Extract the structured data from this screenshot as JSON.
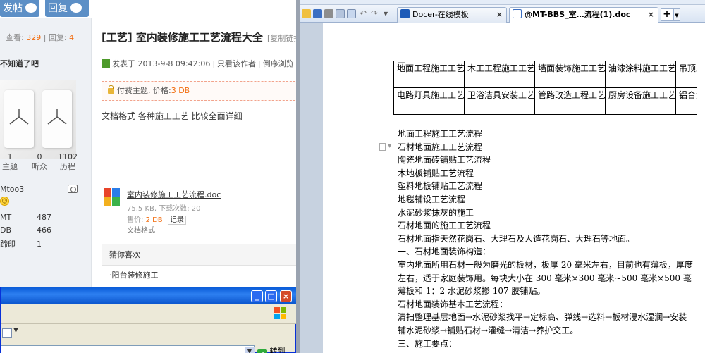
{
  "forum": {
    "top_buttons": {
      "post": "发帖",
      "reply": "回复"
    },
    "sidebar": {
      "stats_prefix_views": "查看:",
      "views": "329",
      "stats_sep": "|",
      "stats_prefix_replies": "回复:",
      "replies": "4",
      "user_name": "不知道了吧",
      "counts": [
        {
          "value": "1",
          "label": "主题"
        },
        {
          "value": "0",
          "label": "听众"
        },
        {
          "value": "1102",
          "label": "历程"
        }
      ],
      "author_id": "Mtoo3",
      "fields": [
        {
          "key": "MT",
          "value": "487"
        },
        {
          "key": "DB",
          "value": "466"
        },
        {
          "key": "蹄印",
          "value": "1"
        }
      ]
    },
    "post": {
      "title": "[工艺] 室内装修施工工艺流程大全",
      "copy_link": "[复制链接",
      "posted_at": "发表于 2013-9-8 09:42:06",
      "only_author": "只看该作者",
      "reverse": "倒序浏览",
      "paid_label": "付费主题, 价格:",
      "paid_price": "3 DB",
      "doc_description": "文档格式 各种施工工艺 比较全面详细"
    },
    "attachment": {
      "name": "室内装修施工工艺流程.doc",
      "size": "75.5 KB, 下载次数: 20",
      "price_label": "售价:",
      "price": "2 DB",
      "record": "记录",
      "format": "文档格式"
    },
    "guess": {
      "header": "猜你喜欢",
      "items": [
        "·阳台装修施工"
      ]
    }
  },
  "xp_window": {
    "buttons": {
      "minimize": "_",
      "maximize": "□",
      "close": "×"
    },
    "go_label": "转到"
  },
  "wps": {
    "tabs": [
      {
        "label": "Docer-在线模板",
        "close": "×"
      },
      {
        "label": "@MT-BBS_室…流程(1).doc",
        "close": "×"
      }
    ],
    "new_tab": "+",
    "table": [
      [
        "地面工程施工工艺流程",
        "木工工程施工工艺流程",
        "墙面装饰施工工艺流程",
        "油漆涂料施工工艺流程",
        "吊顶工艺流"
      ],
      [
        "电路灯具施工工艺流程",
        "卫浴洁具安装工艺流程",
        "管路改造工程工艺流程",
        "厨房设备施工工艺流程",
        "铝合金艺流程"
      ]
    ],
    "body": [
      "地面工程施工工艺流程",
      "石材地面施工工艺流程",
      "陶瓷地面砖铺贴工艺流程",
      "木地板铺贴工艺流程",
      "塑料地板铺贴工艺流程",
      "地毯铺设工艺流程",
      "水泥砂浆抹灰的施工",
      "石材地面的施工工艺流程",
      "石材地面指天然花岗石、大理石及人造花岗石、大理石等地面。",
      "一、石材地面装饰构造：",
      "室内地面所用石材一般为磨光的板材，板厚 20 毫米左右，目前也有薄板，厚度",
      "左右，适于家庭装饰用。每块大小在 300 毫米×300 毫米~500 毫米×500 毫",
      "薄板和 1：2 水泥砂浆掺 107 胶铺贴。",
      "石材地面装饰基本工艺流程：",
      "清扫整理基层地面→水泥砂浆找平→定标高、弹线→选料→板材浸水湿润→安装",
      "铺水泥砂浆→铺贴石材→灌缝→清洁→养护交工。",
      "三、施工要点："
    ]
  }
}
